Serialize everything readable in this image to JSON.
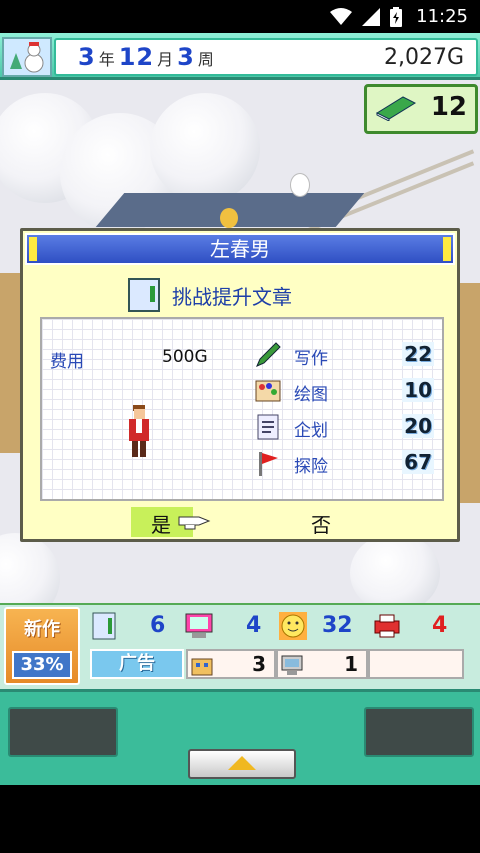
{
  "status_bar": {
    "time": "11:25"
  },
  "header": {
    "date": {
      "year": "3",
      "year_unit": "年",
      "month": "12",
      "month_unit": "月",
      "week": "3",
      "week_unit": "周"
    },
    "money": "2,027G",
    "books_count": "12"
  },
  "dialog": {
    "title": "左春男",
    "task_label": "挑战提升文章",
    "fee_label": "费用",
    "fee_value": "500G",
    "stats": [
      {
        "label": "写作",
        "value": "22",
        "icon": "pencil-icon"
      },
      {
        "label": "绘图",
        "value": "10",
        "icon": "palette-icon"
      },
      {
        "label": "企划",
        "value": "20",
        "icon": "document-icon"
      },
      {
        "label": "探险",
        "value": "67",
        "icon": "flag-icon"
      }
    ],
    "yes_label": "是",
    "no_label": "否"
  },
  "bottom_panel": {
    "new_work_label": "新作",
    "new_work_progress": "33%",
    "counts": [
      {
        "icon": "document-icon",
        "value": "6",
        "color": "#1e45c8"
      },
      {
        "icon": "computer-icon",
        "value": "4",
        "color": "#1e45c8"
      },
      {
        "icon": "smiley-icon",
        "value": "32",
        "color": "#1e45c8"
      },
      {
        "icon": "printer-icon",
        "value": "4",
        "color": "#e02020"
      }
    ],
    "ad_label": "广告",
    "ad_counts": [
      "3",
      "1"
    ]
  }
}
